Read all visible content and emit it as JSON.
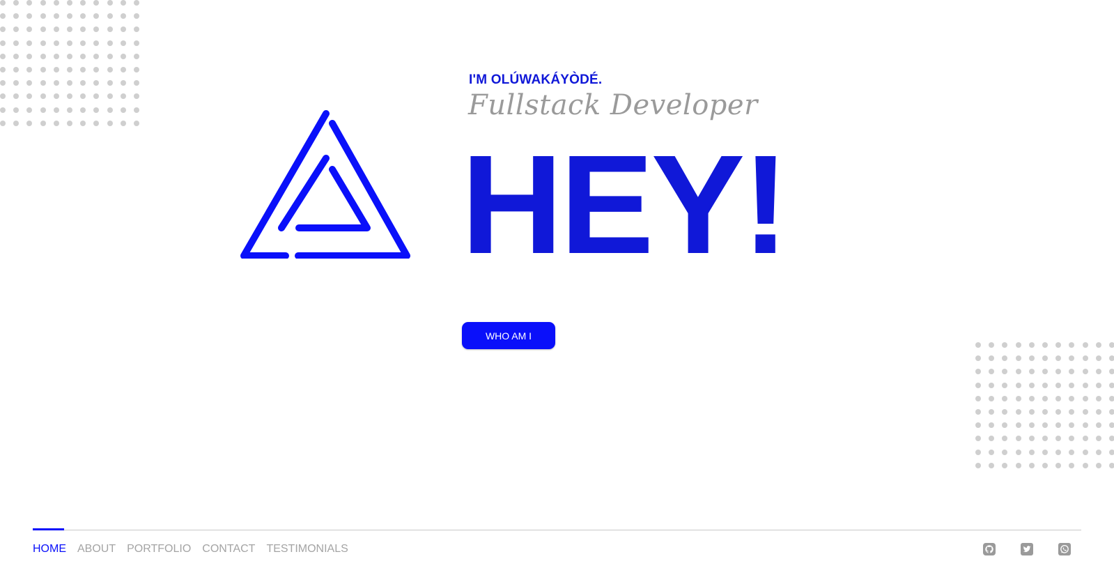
{
  "hero": {
    "intro": "I'M OLÚWAKÁYÒDÉ.",
    "role": "Fullstack Developer",
    "greeting": "HEY!",
    "cta_label": "WHO AM I"
  },
  "nav": {
    "items": [
      {
        "label": "HOME",
        "active": true
      },
      {
        "label": "ABOUT",
        "active": false
      },
      {
        "label": "PORTFOLIO",
        "active": false
      },
      {
        "label": "CONTACT",
        "active": false
      },
      {
        "label": "TESTIMONIALS",
        "active": false
      }
    ]
  },
  "social": {
    "icons": [
      "github-icon",
      "twitter-icon",
      "whatsapp-icon"
    ]
  },
  "colors": {
    "accent": "#0a10fa",
    "heading": "#1018d8",
    "muted": "#a4a4a4",
    "dots": "#cfcfcf"
  }
}
